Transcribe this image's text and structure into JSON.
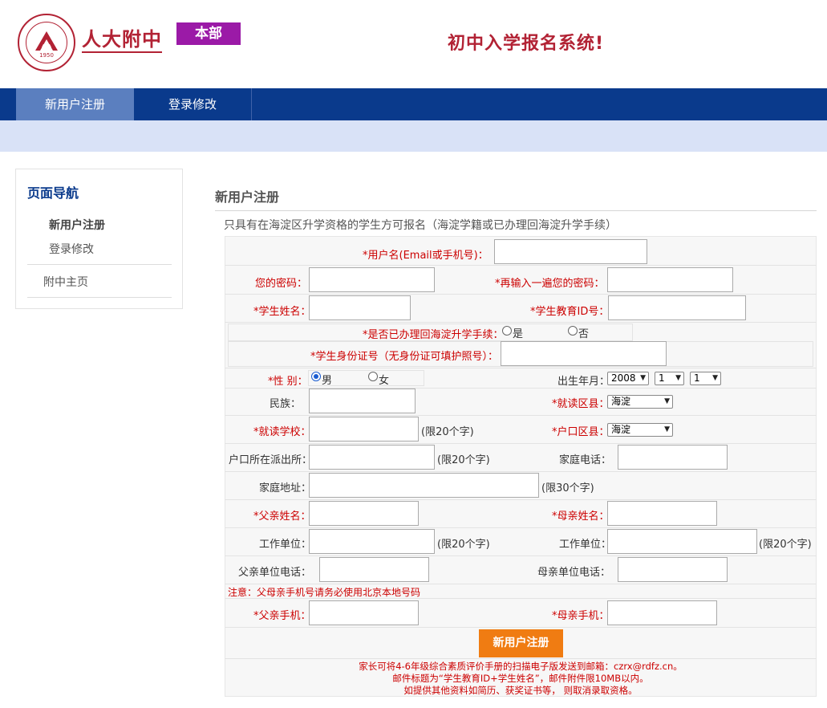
{
  "header": {
    "logo_year": "1950",
    "school_name": "人大附中",
    "campus_badge": "本部",
    "system_title": "初中入学报名系统!"
  },
  "nav": {
    "tabs": [
      {
        "label": "新用户注册",
        "active": true
      },
      {
        "label": "登录修改",
        "active": false
      }
    ]
  },
  "sidebar": {
    "title": "页面导航",
    "items": [
      "新用户注册",
      "登录修改"
    ],
    "home_link": "附中主页"
  },
  "main": {
    "title": "新用户注册",
    "notice": "只具有在海淀区升学资格的学生方可报名（海淀学籍或已办理回海淀升学手续）"
  },
  "form": {
    "username_label": "用户名(Email或手机号)：",
    "password_label": "您的密码：",
    "password_confirm_label": "再输入一遍您的密码：",
    "student_name_label": "学生姓名：",
    "student_edu_id_label": "学生教育ID号：",
    "return_haidian_label": "是否已办理回海淀升学手续：",
    "return_yes": "是",
    "return_no": "否",
    "id_card_label": "学生身份证号（无身份证可填护照号）：",
    "gender_label": "性  别：",
    "gender_male": "男",
    "gender_female": "女",
    "birth_label": "出生年月：",
    "birth_year": "2008",
    "birth_month": "1",
    "birth_day": "1",
    "ethnicity_label": "民族：",
    "school_district_label": "就读区县：",
    "school_district_value": "海淀",
    "school_label": "就读学校：",
    "school_hint": "(限20个字)",
    "hukou_district_label": "户口区县：",
    "hukou_district_value": "海淀",
    "police_station_label": "户口所在派出所：",
    "police_station_hint": "(限20个字)",
    "home_phone_label": "家庭电话：",
    "home_address_label": "家庭地址：",
    "home_address_hint": "(限30个字)",
    "father_name_label": "父亲姓名：",
    "mother_name_label": "母亲姓名：",
    "father_work_label": "工作单位：",
    "father_work_hint": "(限20个字)",
    "mother_work_label": "工作单位：",
    "mother_work_hint": "(限20个字)",
    "father_work_phone_label": "父亲单位电话：",
    "mother_work_phone_label": "母亲单位电话：",
    "phone_warning": "注意：父母亲手机号请务必使用北京本地号码",
    "father_mobile_label": "父亲手机：",
    "mother_mobile_label": "母亲手机：",
    "submit_label": "新用户注册",
    "footer_lines": [
      "家长可将4-6年级综合素质评价手册的扫描电子版发送到邮箱：czrx@rdfz.cn。",
      "邮件标题为“学生教育ID+学生姓名”，邮件附件限10MB以内。",
      "如提供其他资料如简历、获奖证书等， 则取消录取资格。"
    ]
  },
  "colors": {
    "brand_red": "#b22234",
    "nav_blue": "#0a3a8c",
    "nav_active": "#5b7fbf",
    "campus_purple": "#9b1aa7",
    "submit_orange": "#f07c12",
    "subbar": "#d9e2f7"
  }
}
